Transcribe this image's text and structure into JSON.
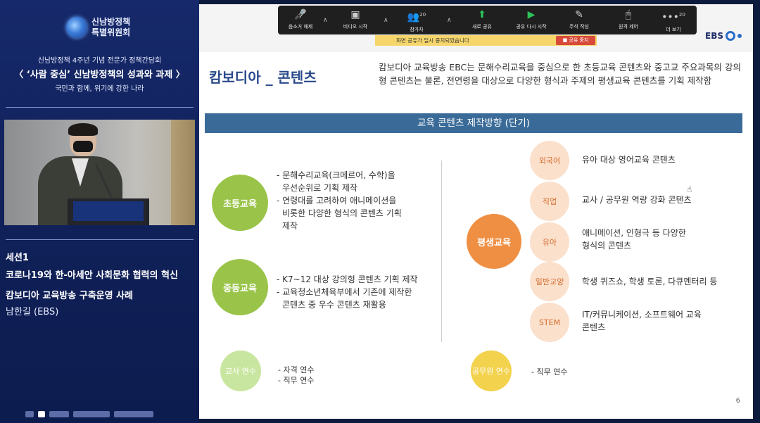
{
  "left_panel": {
    "org_name_line1": "신남방정책",
    "org_name_line2": "특별위원회",
    "event_subtitle": "신남방정책 4주년 기념 전문가 정책간담회",
    "event_title": "〈 ‘사람 중심’ 신남방정책의 성과와 과제 〉",
    "event_tagline": "국민과 함께, 위기에 강한 나라",
    "session_label": "세션1",
    "session_title": "코로나19와 한-아세안 사회문화 협력의 혁신",
    "talk_title": "캄보디아 교육방송 구축운영 사례",
    "speaker": "남한길 (EBS)"
  },
  "toolbar": {
    "mute_label": "음소거 해제",
    "video_label": "비디오 시작",
    "participants_label": "참가자",
    "participants_count": "20",
    "new_share_label": "새로 공유",
    "resume_share_label": "공유 다시 시작",
    "annotate_label": "주석 작성",
    "remote_label": "원격 제어",
    "more_label": "더 보기",
    "more_count": "20",
    "share_paused_text": "화면 공유가 일시 중지되었습니다",
    "stop_share_label": "공유 중지"
  },
  "slide": {
    "logo_text": "EBS",
    "title": "캄보디아 _ 콘텐츠",
    "intro": "캄보디아 교육방송 EBC는 문해수리교육을 중심으로 한 초등교육 콘텐츠와 중고교 주요과목의 강의형 콘텐츠는 물론, 전연령을 대상으로 다양한 형식과 주제의 평생교육 콘텐츠를 기획 제작함",
    "direction_header": "교육 콘텐츠 제작방향 (단기)",
    "elementary": {
      "label": "초등교육",
      "line1": "- 문해수리교육(크메르어, 수학)을",
      "line2": "우선순위로 기획 제작",
      "line3": "- 연령대를 고려하여 애니메이션을",
      "line4": "비롯한 다양한 형식의 콘텐츠 기획",
      "line5": "제작"
    },
    "secondary": {
      "label": "중등교육",
      "line1": "- K7~12 대상 강의형 콘텐츠 기획 제작",
      "line2": "- 교육청소년체육부에서 기존에 제작한",
      "line3": "콘텐츠 중 우수 콘텐츠 재활용"
    },
    "teacher": {
      "label": "교사 연수",
      "line1": "- 자격 연수",
      "line2": "- 직무 연수"
    },
    "lifelong": {
      "label": "평생교육",
      "items": [
        {
          "tag": "외국어",
          "text": "유아 대상 영어교육 콘텐츠"
        },
        {
          "tag": "직업",
          "text": "교사 / 공무원 역량 강화 콘텐츠"
        },
        {
          "tag": "유아",
          "text": "애니메이션, 인형극 등 다양한",
          "text2": "형식의 콘텐츠"
        },
        {
          "tag": "일반교양",
          "text": "학생 퀴즈쇼, 학생 토론, 다큐멘터리 등"
        },
        {
          "tag": "STEM",
          "text": "IT/커뮤니케이션, 소프트웨어 교육",
          "text2": "콘텐츠"
        }
      ]
    },
    "civil": {
      "label": "공무원 연수",
      "line1": "- 직무 연수"
    },
    "page_number": "6"
  }
}
